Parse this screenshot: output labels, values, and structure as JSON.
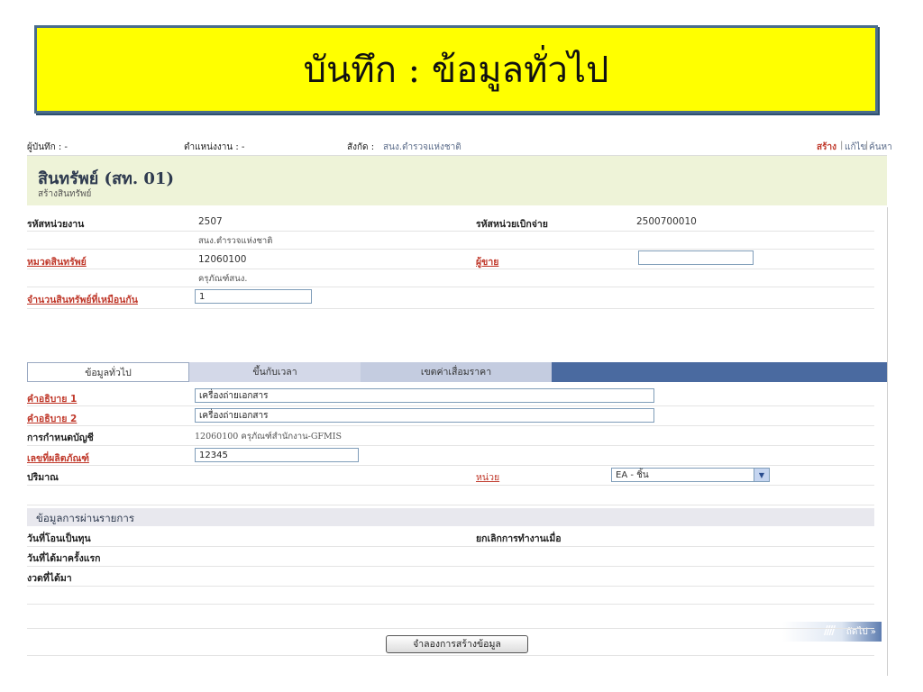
{
  "slide": {
    "title": "บันทึก : ข้อมูลทั่วไป"
  },
  "topbar": {
    "recorder": "ผู้บันทึก : -",
    "position": "ตำแหน่งงาน : -",
    "affiliation_label": "สังกัด :",
    "affiliation_value": "สนง.ตำรวจแห่งชาติ",
    "actions": {
      "create": "สร้าง",
      "edit": "แก้ไข",
      "search": "ค้นหา",
      "sep": "|"
    }
  },
  "header": {
    "title": "สินทรัพย์ (สท. 01)",
    "subtitle": "สร้างสินทรัพย์"
  },
  "form": {
    "unit_code_label": "รหัสหน่วยงาน",
    "unit_code": "2507",
    "unit_name": "สนง.ตำรวจแห่งชาติ",
    "disburse_code_label": "รหัสหน่วยเบิกจ่าย",
    "disburse_code": "2500700010",
    "asset_category_label": "หมวดสินทรัพย์",
    "asset_category_code": "12060100",
    "asset_category_name": "ครุภัณฑ์สนง.",
    "seller_label": "ผู้ขาย",
    "seller_value": "",
    "similar_count_label": "จำนวนสินทรัพย์ที่เหมือนกัน",
    "similar_count": "1"
  },
  "tabs": [
    {
      "label": "ข้อมูลทั่วไป"
    },
    {
      "label": "ขึ้นกับเวลา"
    },
    {
      "label": "เขตค่าเสื่อมราคา"
    }
  ],
  "general": {
    "desc1_label": "คำอธิบาย 1",
    "desc1": "เครื่องถ่ายเอกสาร",
    "desc2_label": "คำอธิบาย 2",
    "desc2": "เครื่องถ่ายเอกสาร",
    "account_label": "การกำหนดบัญชี",
    "account_value": "12060100 ครุภัณฑ์สำนักงาน-GFMIS",
    "product_no_label": "เลขที่ผลิตภัณฑ์",
    "product_no": "12345",
    "quantity_label": "ปริมาณ",
    "unit_label": "หน่วย",
    "unit_selected": "EA - ชิ้น"
  },
  "posting": {
    "section_title": "ข้อมูลการผ่านรายการ",
    "capitalize_label": "วันที่โอนเป็นทุน",
    "cancel_label": "ยกเลิกการทำงานเมื่อ",
    "first_acquired_label": "วันที่ได้มาครั้งแรก",
    "period_label": "งวดที่ได้มา"
  },
  "buttons": {
    "next": "ถัดไป »",
    "simulate": "จำลองการสร้างข้อมูล"
  },
  "colors": {
    "banner_bg": "#ffff00",
    "tab_bar": "#4a6aa0",
    "link_red": "#c0392b",
    "header_bg": "#eef3d8"
  }
}
